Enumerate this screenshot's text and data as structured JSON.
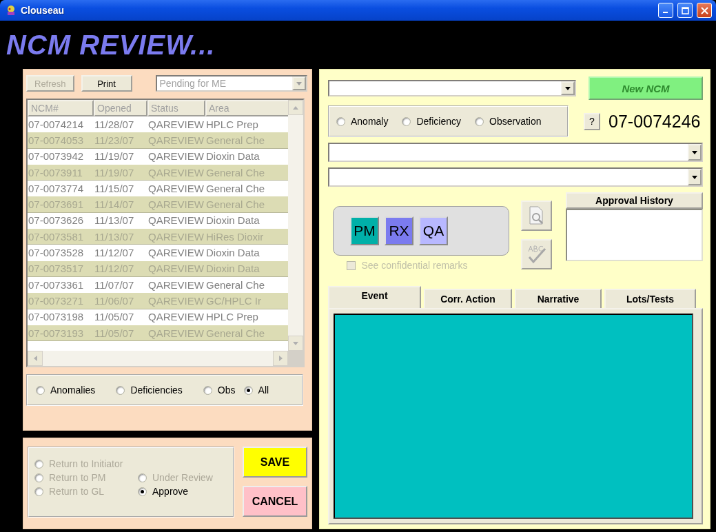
{
  "window": {
    "title": "Clouseau"
  },
  "header": {
    "title": "NCM REVIEW..."
  },
  "list_panel": {
    "refresh": {
      "label": "Refresh",
      "disabled": true
    },
    "print": {
      "label": "Print",
      "disabled": false
    },
    "view_select": {
      "value": "Pending for ME",
      "disabled": true
    },
    "table": {
      "columns": [
        "NCM#",
        "Opened",
        "Status",
        "Area"
      ],
      "rows": [
        [
          "07-0074214",
          "11/28/07",
          "QAREVIEW",
          "HPLC Prep"
        ],
        [
          "07-0074053",
          "11/23/07",
          "QAREVIEW",
          "General Che"
        ],
        [
          "07-0073942",
          "11/19/07",
          "QAREVIEW",
          "Dioxin Data"
        ],
        [
          "07-0073911",
          "11/19/07",
          "QAREVIEW",
          "General Che"
        ],
        [
          "07-0073774",
          "11/15/07",
          "QAREVIEW",
          "General Che"
        ],
        [
          "07-0073691",
          "11/14/07",
          "QAREVIEW",
          "General Che"
        ],
        [
          "07-0073626",
          "11/13/07",
          "QAREVIEW",
          "Dioxin Data"
        ],
        [
          "07-0073581",
          "11/13/07",
          "QAREVIEW",
          "HiRes Dioxir"
        ],
        [
          "07-0073528",
          "11/12/07",
          "QAREVIEW",
          "Dioxin Data"
        ],
        [
          "07-0073517",
          "11/12/07",
          "QAREVIEW",
          "Dioxin Data"
        ],
        [
          "07-0073361",
          "11/07/07",
          "QAREVIEW",
          "General Che"
        ],
        [
          "07-0073271",
          "11/06/07",
          "QAREVIEW",
          "GC/HPLC Ir"
        ],
        [
          "07-0073198",
          "11/05/07",
          "QAREVIEW",
          "HPLC Prep"
        ],
        [
          "07-0073193",
          "11/05/07",
          "QAREVIEW",
          "General Che"
        ]
      ]
    },
    "filters": [
      {
        "label": "Anomalies",
        "selected": false
      },
      {
        "label": "Deficiencies",
        "selected": false
      },
      {
        "label": "Obs",
        "selected": false
      },
      {
        "label": "All",
        "selected": true
      }
    ]
  },
  "action_panel": {
    "options": [
      {
        "label": "Return to Initiator",
        "selected": false,
        "disabled": true
      },
      {
        "label": "Return to PM",
        "selected": false,
        "disabled": true
      },
      {
        "label": "Under Review",
        "selected": false,
        "disabled": true
      },
      {
        "label": "Return to GL",
        "selected": false,
        "disabled": true
      },
      {
        "label": "Approve",
        "selected": true,
        "disabled": false
      }
    ],
    "save": {
      "label": "SAVE"
    },
    "cancel": {
      "label": "CANCEL"
    }
  },
  "detail_panel": {
    "new_ncm": {
      "label": "New NCM",
      "disabled": true
    },
    "types": [
      {
        "label": "Anomaly",
        "selected": false
      },
      {
        "label": "Deficiency",
        "selected": false
      },
      {
        "label": "Observation",
        "selected": false
      }
    ],
    "help": {
      "label": "?"
    },
    "ncm_number": "07-0074246",
    "roles": [
      {
        "label": "PM",
        "color": "#00b0a8"
      },
      {
        "label": "RX",
        "color": "#7b7bef"
      },
      {
        "label": "QA",
        "color": "#b8b8ff"
      }
    ],
    "confidential": {
      "label": "See confidential remarks",
      "checked": false,
      "disabled": true
    },
    "approval_history": {
      "label": "Approval History"
    },
    "tabs": [
      {
        "label": "Event",
        "selected": true
      },
      {
        "label": "Corr. Action",
        "selected": false
      },
      {
        "label": "Narrative",
        "selected": false
      },
      {
        "label": "Lots/Tests",
        "selected": false
      }
    ]
  }
}
